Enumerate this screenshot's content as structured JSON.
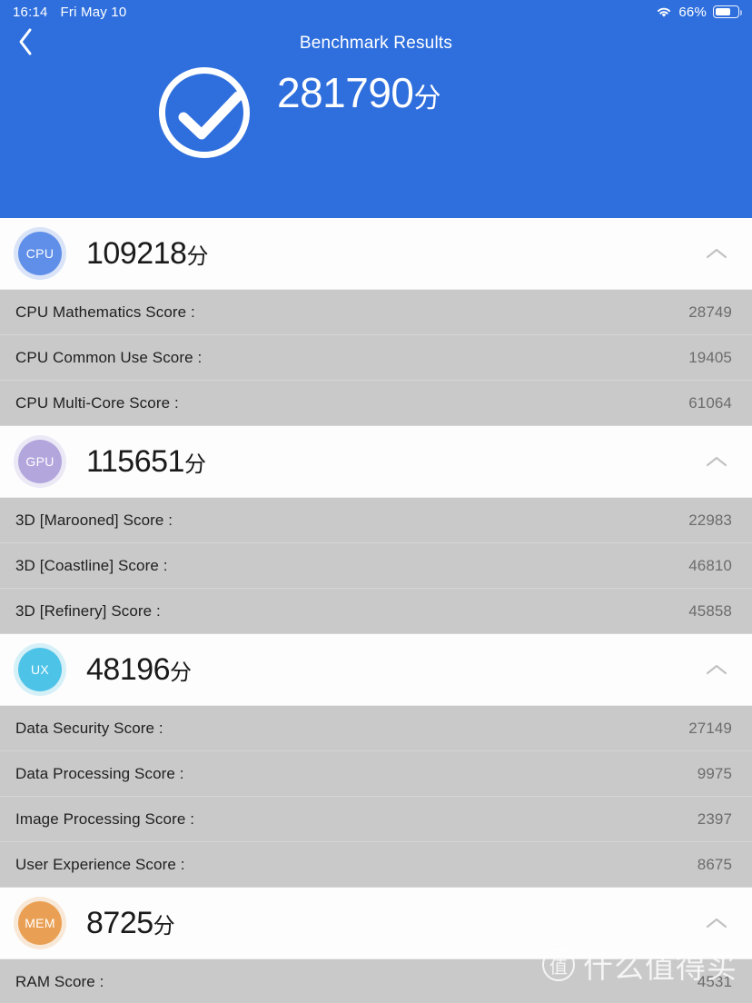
{
  "status_bar": {
    "time": "16:14",
    "date": "Fri May 10",
    "wifi_icon": "wifi-icon",
    "battery_percent": "66%",
    "battery_icon": "battery-icon"
  },
  "nav": {
    "back_icon": "chevron-left-icon",
    "title": "Benchmark Results"
  },
  "hero": {
    "check_icon": "check-circle-icon",
    "total_score": "281790",
    "score_unit": "分",
    "background_color": "#2f6fdd"
  },
  "sections": [
    {
      "badge": "CPU",
      "badge_color": "#5f8fe8",
      "score": "109218",
      "unit": "分",
      "collapse_icon": "chevron-up-icon",
      "rows": [
        {
          "label": "CPU Mathematics Score :",
          "value": "28749"
        },
        {
          "label": "CPU Common Use Score :",
          "value": "19405"
        },
        {
          "label": "CPU Multi-Core Score :",
          "value": "61064"
        }
      ]
    },
    {
      "badge": "GPU",
      "badge_color": "#b3a6dd",
      "score": "115651",
      "unit": "分",
      "collapse_icon": "chevron-up-icon",
      "rows": [
        {
          "label": "3D [Marooned] Score :",
          "value": "22983"
        },
        {
          "label": "3D [Coastline] Score :",
          "value": "46810"
        },
        {
          "label": "3D [Refinery] Score :",
          "value": "45858"
        }
      ]
    },
    {
      "badge": "UX",
      "badge_color": "#4ec3e8",
      "score": "48196",
      "unit": "分",
      "collapse_icon": "chevron-up-icon",
      "rows": [
        {
          "label": "Data Security Score :",
          "value": "27149"
        },
        {
          "label": "Data Processing Score :",
          "value": "9975"
        },
        {
          "label": "Image Processing Score :",
          "value": "2397"
        },
        {
          "label": "User Experience Score :",
          "value": "8675"
        }
      ]
    },
    {
      "badge": "MEM",
      "badge_color": "#eaa054",
      "score": "8725",
      "unit": "分",
      "collapse_icon": "chevron-up-icon",
      "rows": [
        {
          "label": "RAM Score :",
          "value": "4531"
        }
      ]
    }
  ],
  "watermark": {
    "logo_text": "值",
    "text": "什么值得买"
  }
}
